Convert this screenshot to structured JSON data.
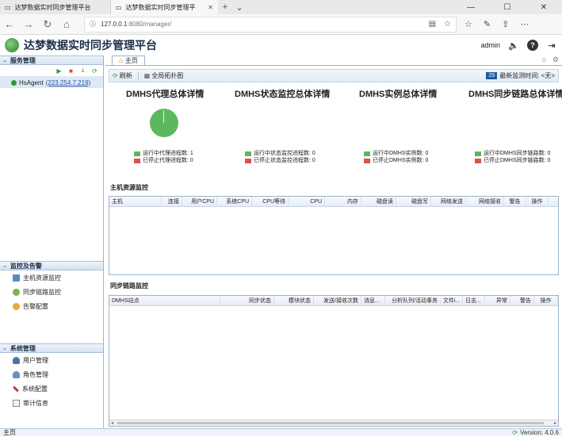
{
  "browser": {
    "tabs": [
      {
        "title": "达梦数据实时同步管理平台",
        "active": false
      },
      {
        "title": "达梦数据实时同步管理平",
        "active": true
      }
    ],
    "url_host": "127.0.0.1",
    "url_rest": ":8080/manager/"
  },
  "app": {
    "title": "达梦数据实时同步管理平台",
    "user": "admin"
  },
  "sidebar": {
    "service_header": "服务管理",
    "agents": [
      {
        "name": "HsAgent",
        "address": "(223.254.7.219)"
      }
    ],
    "monitor_header": "监控及告警",
    "monitor_items": [
      {
        "label": "主机资源监控",
        "icon": "host-monitor-icon"
      },
      {
        "label": "同步链路监控",
        "icon": "sync-link-icon"
      },
      {
        "label": "告警配置",
        "icon": "alarm-config-icon"
      }
    ],
    "system_header": "系统管理",
    "system_items": [
      {
        "label": "用户管理",
        "icon": "user-icon"
      },
      {
        "label": "角色管理",
        "icon": "role-icon"
      },
      {
        "label": "系统配置",
        "icon": "tools-icon"
      },
      {
        "label": "审计信息",
        "icon": "audit-icon"
      }
    ]
  },
  "main": {
    "tab_label": "主页",
    "toolbar": {
      "refresh": "刷新",
      "topology": "全局拓扑图",
      "interval": "29",
      "latest_time": "最新监测时间: <无>"
    },
    "summaries": [
      {
        "title": "DMHS代理总体详情",
        "running": "运行中代理进程数: 1",
        "stopped": "已停止代理进程数: 0",
        "has_pie": true
      },
      {
        "title": "DMHS状态监控总体详情",
        "running": "运行中状态监控进程数: 0",
        "stopped": "已停止状态监控进程数: 0",
        "has_pie": false
      },
      {
        "title": "DMHS实例总体详情",
        "running": "运行中DMHS实例数: 0",
        "stopped": "已停止DMHS实例数: 0",
        "has_pie": false
      },
      {
        "title": "DMHS同步链路总体详情",
        "running": "运行中DMHS同步链路数: 0",
        "stopped": "已停止DMHS同步链路数: 0",
        "has_pie": false
      }
    ],
    "host_section_title": "主机资源监控",
    "host_columns": [
      "主机",
      "连接",
      "用户CPU",
      "系统CPU",
      "CPU等待",
      "CPU",
      "内存",
      "磁盘读",
      "磁盘写",
      "网络发送",
      "网络接收",
      "警告",
      "操作"
    ],
    "sync_section_title": "同步链路监控",
    "sync_columns": [
      "DMHS站点",
      "同步状态",
      "模块状态",
      "发送/接收次数",
      "消息...",
      "分析队列/活动事务",
      "文件i...",
      "日志...",
      "异常",
      "警告",
      "操作"
    ]
  },
  "status": {
    "left": "主页",
    "version": "Version: 4.0.6"
  },
  "colors": {
    "running": "#5cb85c",
    "stopped": "#d9534f",
    "accent": "#1e5aa0"
  }
}
